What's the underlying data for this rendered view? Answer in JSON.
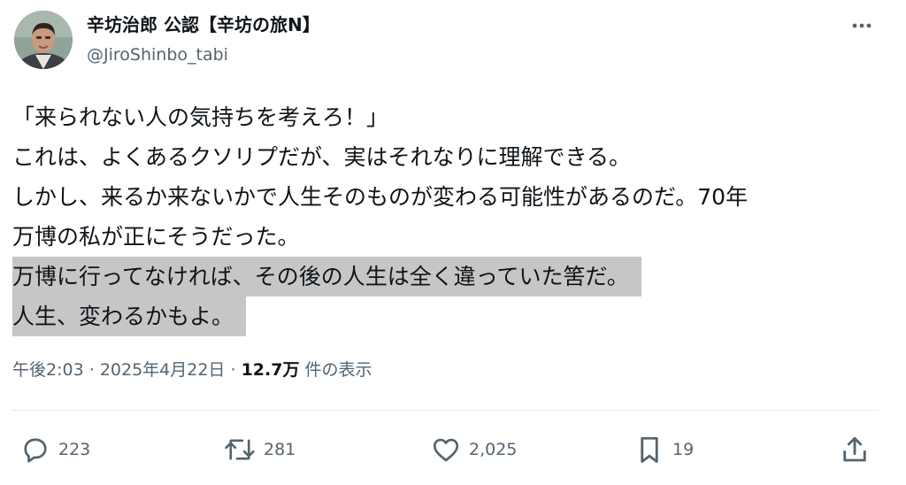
{
  "author": {
    "display_name": "辛坊治郎 公認【辛坊の旅N】",
    "handle": "@JiroShinbo_tabi"
  },
  "tweet": {
    "lines": [
      "「来られない人の気持ちを考えろ！」",
      "これは、よくあるクソリプだが、実はそれなりに理解できる。",
      "しかし、来るか来ないかで人生そのものが変わる可能性があるのだ。70年",
      "万博の私が正にそうだった。",
      "万博に行ってなければ、その後の人生は全く違っていた筈だ。",
      "人生、変わるかもよ。"
    ],
    "highlighted_lines": [
      4,
      5
    ]
  },
  "meta": {
    "time": "午後2:03",
    "separator": "·",
    "date": "2025年4月22日",
    "views_count": "12.7万",
    "views_label": "件の表示"
  },
  "actions": {
    "replies": "223",
    "reposts": "281",
    "likes": "2,025",
    "bookmarks": "19"
  },
  "icons": {
    "more": "more-horizontal-icon",
    "reply": "reply-bubble-icon",
    "repost": "repost-arrows-icon",
    "like": "heart-icon",
    "bookmark": "bookmark-icon",
    "share": "share-upload-icon"
  },
  "colors": {
    "text_primary": "#0f1419",
    "text_secondary": "#536471",
    "highlight": "#c6c6c6",
    "divider": "#e6e9eb"
  }
}
